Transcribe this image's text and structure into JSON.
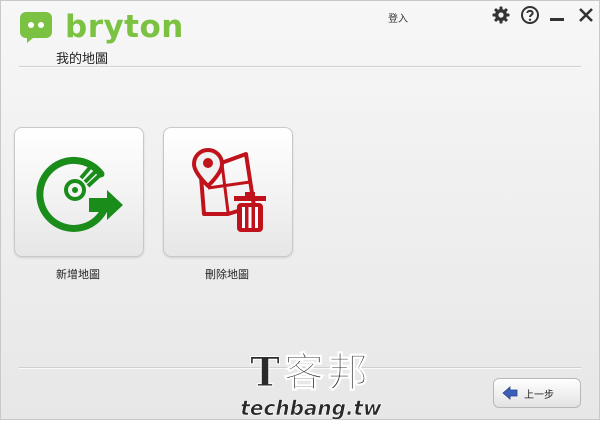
{
  "brand": {
    "name": "bryton",
    "color": "#7cc242"
  },
  "header": {
    "login_label": "登入",
    "icons": [
      "gear-icon",
      "help-icon",
      "minimize-icon",
      "close-icon"
    ]
  },
  "page": {
    "title": "我的地圖"
  },
  "tiles": [
    {
      "label": "新增地圖",
      "icon": "add-map-icon",
      "color": "#1a8c1a"
    },
    {
      "label": "刪除地圖",
      "icon": "delete-map-icon",
      "color": "#c0121b"
    }
  ],
  "footer": {
    "back_label": "上一步",
    "back_icon": "left-arrow-icon"
  },
  "watermark": {
    "chinese": "T客邦",
    "english": "techbang.tw"
  }
}
